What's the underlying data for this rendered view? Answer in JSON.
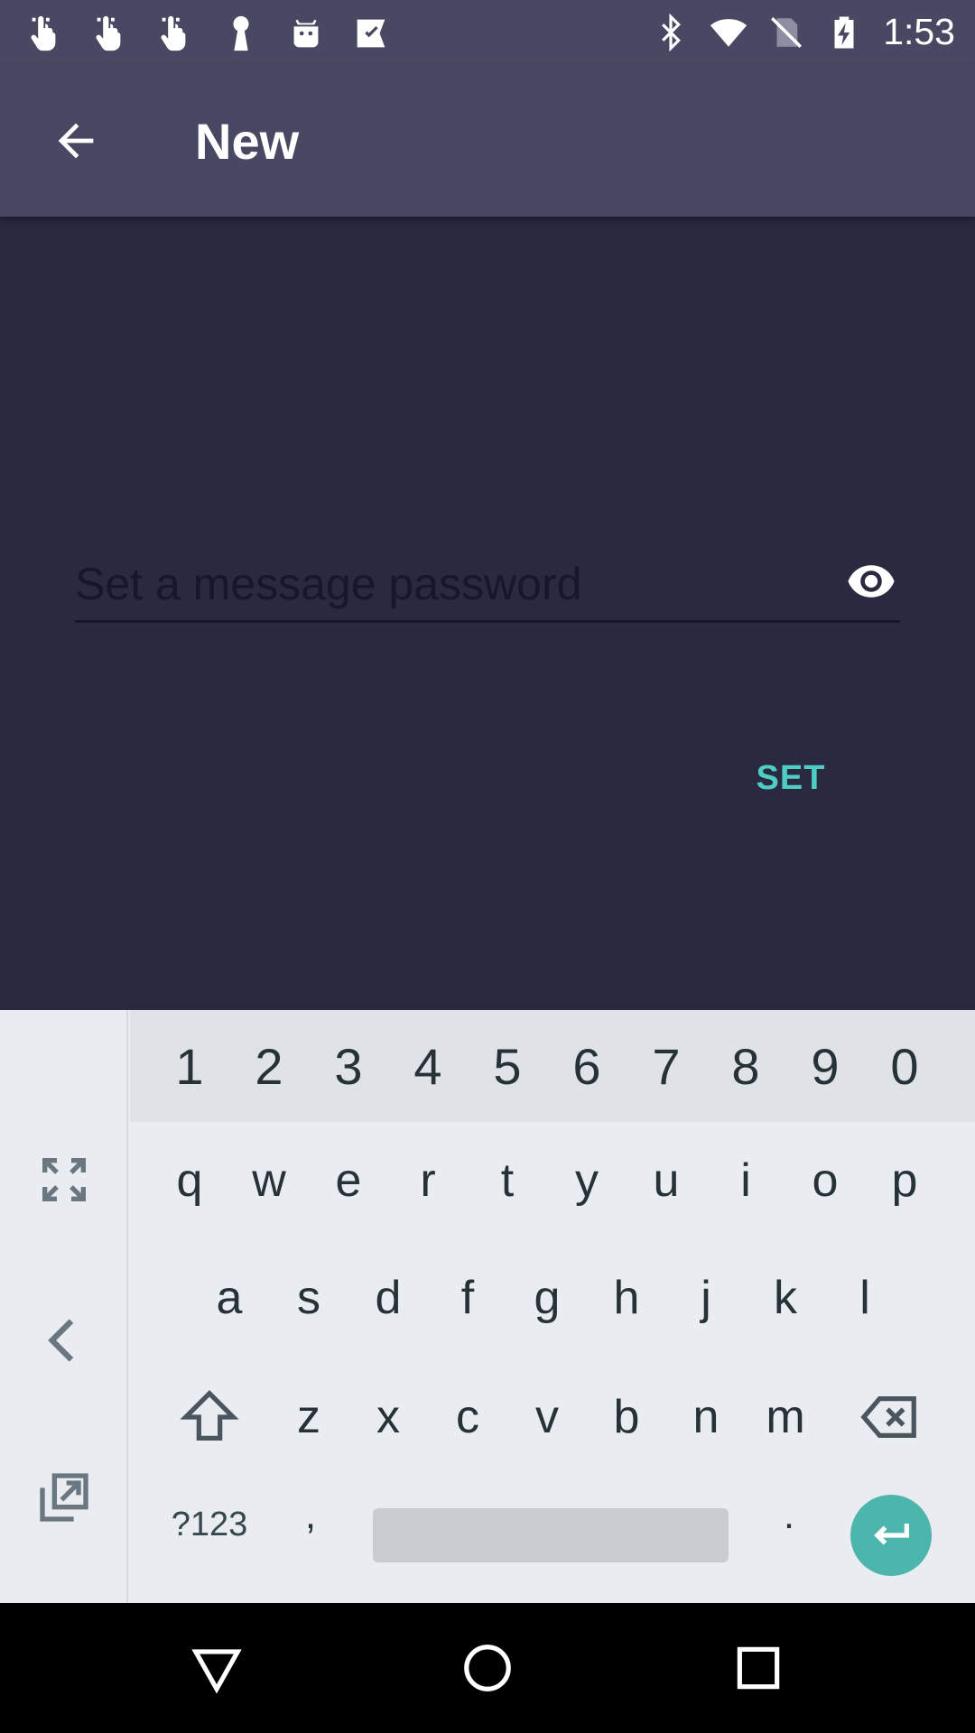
{
  "status_bar": {
    "time": "1:53",
    "left_icons": [
      "finger-touch-icon",
      "finger-touch-icon",
      "finger-touch-icon",
      "keyhole-icon",
      "android-icon",
      "check-ticket-icon"
    ],
    "right_icons": [
      "bluetooth-icon",
      "wifi-icon",
      "no-sim-icon",
      "battery-charging-icon"
    ]
  },
  "app_bar": {
    "title": "New",
    "back_icon": "arrow-back-icon"
  },
  "password_field": {
    "placeholder": "Set a message password",
    "value": "",
    "toggle_icon": "eye-icon"
  },
  "set_button": {
    "label": "SET",
    "color": "#4ecdc4"
  },
  "keyboard": {
    "number_row": [
      "1",
      "2",
      "3",
      "4",
      "5",
      "6",
      "7",
      "8",
      "9",
      "0"
    ],
    "row1": [
      "q",
      "w",
      "e",
      "r",
      "t",
      "y",
      "u",
      "i",
      "o",
      "p"
    ],
    "row2": [
      "a",
      "s",
      "d",
      "f",
      "g",
      "h",
      "j",
      "k",
      "l"
    ],
    "row3": [
      "z",
      "x",
      "c",
      "v",
      "b",
      "n",
      "m"
    ],
    "symbols_label": "?123",
    "comma_label": ",",
    "period_label": ".",
    "side_icons": [
      "fullscreen-icon",
      "chevron-left-icon",
      "open-external-icon"
    ],
    "enter_color": "#4db6ac"
  },
  "nav_bar": {
    "icons": [
      "back-triangle-icon",
      "home-circle-icon",
      "recents-square-icon"
    ]
  },
  "colors": {
    "background": "#2a2940",
    "app_bar": "#494862",
    "accent": "#4ecdc4"
  }
}
